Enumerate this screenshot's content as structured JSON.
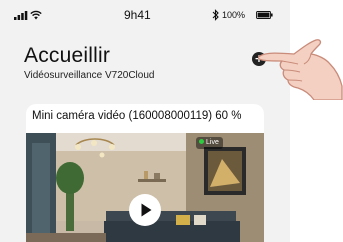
{
  "status_bar": {
    "time": "9h41",
    "battery": "100%",
    "icons": [
      "signal-icon",
      "wifi-icon",
      "bluetooth-icon",
      "battery-icon"
    ]
  },
  "header": {
    "title": "Accueillir",
    "subtitle": "Vidéosurveillance V720Cloud",
    "add_icon": "plus-circle-icon"
  },
  "camera_card": {
    "title": "Mini caméra vidéo (160008000119) 60 %",
    "live_label": "Live",
    "play_icon": "play-icon"
  },
  "colors": {
    "app_background": "#f2f2f2",
    "card_background": "#ffffff",
    "text": "#111111",
    "live_dot": "#2ecc40"
  }
}
